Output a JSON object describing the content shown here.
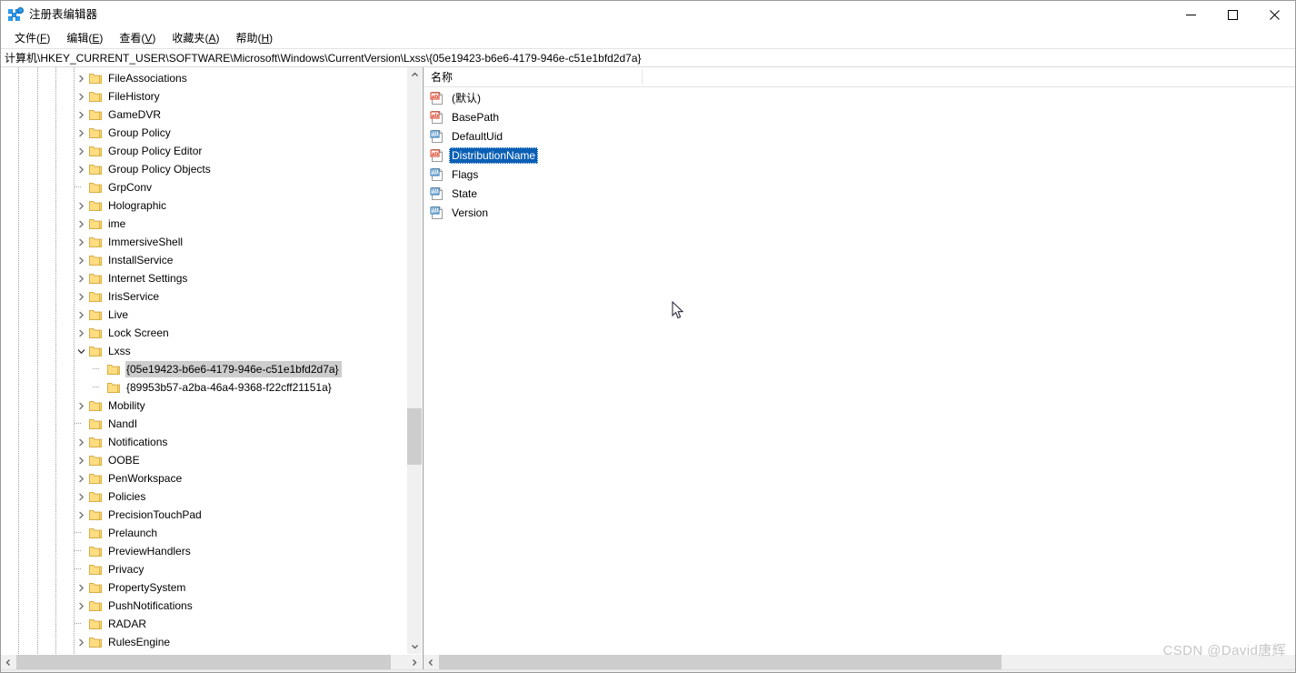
{
  "window": {
    "title": "注册表编辑器",
    "icon": "registry-editor-icon",
    "controls": {
      "minimize": "最小化",
      "maximize": "最大化",
      "close": "关闭"
    }
  },
  "menubar": {
    "items": [
      {
        "label": "文件(F)",
        "text": "文件",
        "accel": "F"
      },
      {
        "label": "编辑(E)",
        "text": "编辑",
        "accel": "E"
      },
      {
        "label": "查看(V)",
        "text": "查看",
        "accel": "V"
      },
      {
        "label": "收藏夹(A)",
        "text": "收藏夹",
        "accel": "A"
      },
      {
        "label": "帮助(H)",
        "text": "帮助",
        "accel": "H"
      }
    ]
  },
  "address": {
    "path": "计算机\\HKEY_CURRENT_USER\\SOFTWARE\\Microsoft\\Windows\\CurrentVersion\\Lxss\\{05e19423-b6e6-4179-946e-c51e1bfd2d7a}"
  },
  "tree": {
    "items": [
      {
        "label": "FileAssociations",
        "depth": 4,
        "expandable": true,
        "expanded": false,
        "selected": false
      },
      {
        "label": "FileHistory",
        "depth": 4,
        "expandable": true,
        "expanded": false,
        "selected": false
      },
      {
        "label": "GameDVR",
        "depth": 4,
        "expandable": true,
        "expanded": false,
        "selected": false
      },
      {
        "label": "Group Policy",
        "depth": 4,
        "expandable": true,
        "expanded": false,
        "selected": false
      },
      {
        "label": "Group Policy Editor",
        "depth": 4,
        "expandable": true,
        "expanded": false,
        "selected": false
      },
      {
        "label": "Group Policy Objects",
        "depth": 4,
        "expandable": true,
        "expanded": false,
        "selected": false
      },
      {
        "label": "GrpConv",
        "depth": 4,
        "expandable": false,
        "expanded": false,
        "selected": false
      },
      {
        "label": "Holographic",
        "depth": 4,
        "expandable": true,
        "expanded": false,
        "selected": false
      },
      {
        "label": "ime",
        "depth": 4,
        "expandable": true,
        "expanded": false,
        "selected": false
      },
      {
        "label": "ImmersiveShell",
        "depth": 4,
        "expandable": true,
        "expanded": false,
        "selected": false
      },
      {
        "label": "InstallService",
        "depth": 4,
        "expandable": true,
        "expanded": false,
        "selected": false
      },
      {
        "label": "Internet Settings",
        "depth": 4,
        "expandable": true,
        "expanded": false,
        "selected": false
      },
      {
        "label": "IrisService",
        "depth": 4,
        "expandable": true,
        "expanded": false,
        "selected": false
      },
      {
        "label": "Live",
        "depth": 4,
        "expandable": true,
        "expanded": false,
        "selected": false
      },
      {
        "label": "Lock Screen",
        "depth": 4,
        "expandable": true,
        "expanded": false,
        "selected": false
      },
      {
        "label": "Lxss",
        "depth": 4,
        "expandable": true,
        "expanded": true,
        "selected": false
      },
      {
        "label": "{05e19423-b6e6-4179-946e-c51e1bfd2d7a}",
        "depth": 5,
        "expandable": false,
        "expanded": false,
        "selected": true
      },
      {
        "label": "{89953b57-a2ba-46a4-9368-f22cff21151a}",
        "depth": 5,
        "expandable": false,
        "expanded": false,
        "selected": false
      },
      {
        "label": "Mobility",
        "depth": 4,
        "expandable": true,
        "expanded": false,
        "selected": false
      },
      {
        "label": "NandI",
        "depth": 4,
        "expandable": false,
        "expanded": false,
        "selected": false
      },
      {
        "label": "Notifications",
        "depth": 4,
        "expandable": true,
        "expanded": false,
        "selected": false
      },
      {
        "label": "OOBE",
        "depth": 4,
        "expandable": true,
        "expanded": false,
        "selected": false
      },
      {
        "label": "PenWorkspace",
        "depth": 4,
        "expandable": true,
        "expanded": false,
        "selected": false
      },
      {
        "label": "Policies",
        "depth": 4,
        "expandable": true,
        "expanded": false,
        "selected": false
      },
      {
        "label": "PrecisionTouchPad",
        "depth": 4,
        "expandable": true,
        "expanded": false,
        "selected": false
      },
      {
        "label": "Prelaunch",
        "depth": 4,
        "expandable": false,
        "expanded": false,
        "selected": false
      },
      {
        "label": "PreviewHandlers",
        "depth": 4,
        "expandable": false,
        "expanded": false,
        "selected": false
      },
      {
        "label": "Privacy",
        "depth": 4,
        "expandable": false,
        "expanded": false,
        "selected": false
      },
      {
        "label": "PropertySystem",
        "depth": 4,
        "expandable": true,
        "expanded": false,
        "selected": false
      },
      {
        "label": "PushNotifications",
        "depth": 4,
        "expandable": true,
        "expanded": false,
        "selected": false
      },
      {
        "label": "RADAR",
        "depth": 4,
        "expandable": false,
        "expanded": false,
        "selected": false
      },
      {
        "label": "RulesEngine",
        "depth": 4,
        "expandable": true,
        "expanded": false,
        "selected": false
      }
    ]
  },
  "values": {
    "columns": [
      {
        "label": "名称"
      }
    ],
    "rows": [
      {
        "name": "(默认)",
        "type": "string",
        "selected": false
      },
      {
        "name": "BasePath",
        "type": "string",
        "selected": false
      },
      {
        "name": "DefaultUid",
        "type": "dword",
        "selected": false
      },
      {
        "name": "DistributionName",
        "type": "string",
        "selected": true
      },
      {
        "name": "Flags",
        "type": "dword",
        "selected": false
      },
      {
        "name": "State",
        "type": "dword",
        "selected": false
      },
      {
        "name": "Version",
        "type": "dword",
        "selected": false
      }
    ]
  },
  "watermark": {
    "text": "CSDN @David唐辉"
  },
  "colors": {
    "selection_focused": "#0a5fb5",
    "selection_unfocused": "#cdcdcd",
    "folder": "#ffd966",
    "string_icon": "#d9381e",
    "binary_icon": "#1a6fb5",
    "scrollbar_track": "#f0f0f0",
    "scrollbar_thumb": "#cdcdcd"
  }
}
